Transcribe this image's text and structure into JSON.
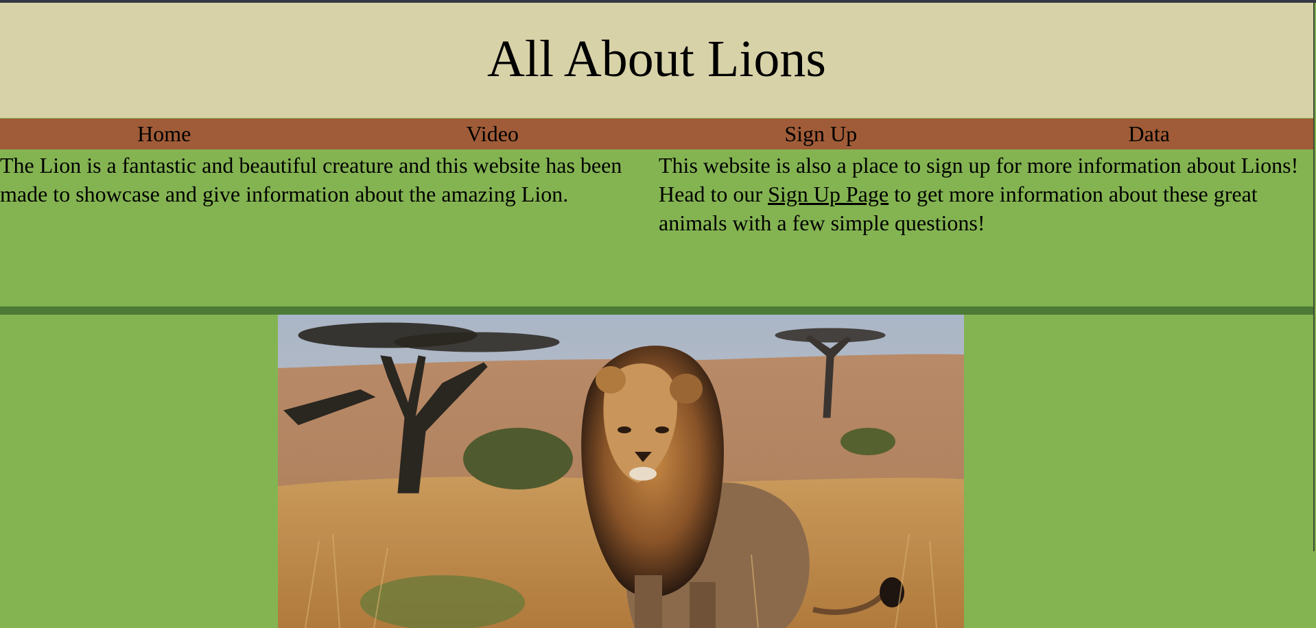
{
  "header": {
    "title": "All About Lions"
  },
  "nav": {
    "items": [
      {
        "label": "Home"
      },
      {
        "label": "Video"
      },
      {
        "label": "Sign Up"
      },
      {
        "label": "Data"
      }
    ]
  },
  "intro": {
    "left_text": "The Lion is a fantastic and beautiful creature and this website has been made to showcase and give information about the amazing Lion.",
    "right_before": "This website is also a place to sign up for more information about Lions! Head to our ",
    "right_link": "Sign Up Page",
    "right_after": " to get more information about these great animals with a few simple questions!"
  },
  "colors": {
    "header_bg": "#d8d2a8",
    "nav_bg": "#a05c38",
    "content_bg": "#84b452",
    "divider": "#4d7a35"
  },
  "hero_image": {
    "icon": "lion-photo"
  }
}
